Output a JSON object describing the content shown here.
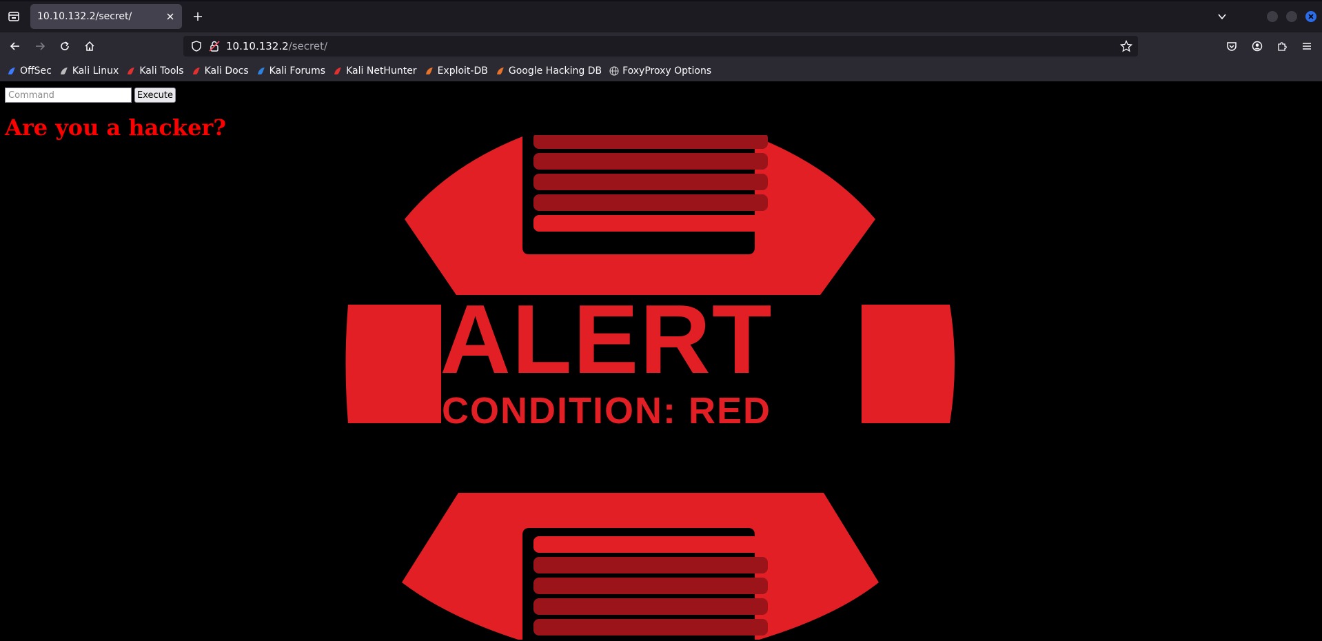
{
  "browser": {
    "tab_title": "10.10.132.2/secret/",
    "url_host": "10.10.132.2",
    "url_path": "/secret/",
    "bookmarks": [
      {
        "label": "OffSec",
        "icon": "offsec-icon",
        "color": "#3d7bff"
      },
      {
        "label": "Kali Linux",
        "icon": "kali-dragon-icon",
        "color": "#bbbbbb"
      },
      {
        "label": "Kali Tools",
        "icon": "kali-tools-icon",
        "color": "#e0312f"
      },
      {
        "label": "Kali Docs",
        "icon": "kali-docs-icon",
        "color": "#e0312f"
      },
      {
        "label": "Kali Forums",
        "icon": "kali-forums-icon",
        "color": "#2f82e0"
      },
      {
        "label": "Kali NetHunter",
        "icon": "kali-nethunter-icon",
        "color": "#e0312f"
      },
      {
        "label": "Exploit-DB",
        "icon": "exploit-db-icon",
        "color": "#e8742c"
      },
      {
        "label": "Google Hacking DB",
        "icon": "ghdb-icon",
        "color": "#e8742c"
      },
      {
        "label": "FoxyProxy Options",
        "icon": "globe-icon",
        "color": "#cccccc"
      }
    ]
  },
  "page": {
    "command_placeholder": "Command",
    "execute_label": "Execute",
    "headline": "Are you a hacker?",
    "logo": {
      "word": "ALERT",
      "subtitle": "CONDITION: RED",
      "primary_color": "#e21f25",
      "stripe_color": "#9a141a"
    }
  }
}
